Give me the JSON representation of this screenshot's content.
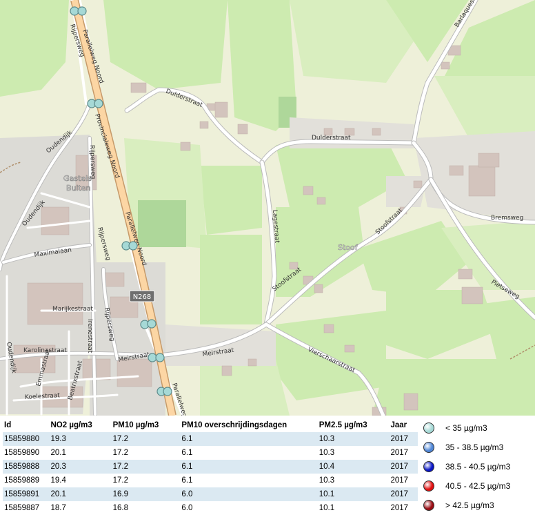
{
  "map": {
    "place_labels": [
      "Gastels",
      "Buiten",
      "Stoof"
    ],
    "shield": "N268",
    "roads": {
      "provincialeweg": "Provincialeweg Noord",
      "parallelweg_top": "Parallelweg Noord",
      "parallelweg_mid": "Parallelweg Noord",
      "parallelweg_bottom": "Parallelweg",
      "rijpersweg_1": "Rijpersweg",
      "rijpersweg_2": "Rijpersweg",
      "rijpersweg_3": "Rijpersweg",
      "rijpersweg_4": "Rijpersweg",
      "dulderstraat_1": "Dulderstraat",
      "dulderstraat_2": "Dulderstraat",
      "oudendijk_1": "Oudendijk",
      "oudendijk_2": "Oudendijk",
      "oudendijk_3": "Oudendijk",
      "maximalaan": "Maximalaan",
      "lagestraat": "Lagestraat",
      "stoofstraat_1": "Stoofstraat",
      "stoofstraat_2": "Stoofstraat",
      "barlaquestraat": "Barlaquest",
      "bremsweg": "Bremsweg",
      "pietseweg": "Pietseweg",
      "marijkestraat": "Marijkestraat",
      "irenestraat": "Irenestraat",
      "karolinastraat": "Karolinastraat",
      "meirstraat_1": "Meirstraat",
      "meirstraat_2": "Meirstraat",
      "vierschaarstraat": "Vierschaarstraat",
      "emmastraat": "Emmastraat",
      "beatrixstraat": "Beatrixstraat",
      "koelestraat": "Koelestraat"
    },
    "marker_color": "#a6d9d6"
  },
  "table": {
    "headers": [
      "Id",
      "NO2 µg/m3",
      "PM10 µg/m3",
      "PM10 overschrijdingsdagen",
      "PM2.5 µg/m3",
      "Jaar"
    ],
    "rows": [
      [
        "15859880",
        "19.3",
        "17.2",
        "6.1",
        "10.3",
        "2017"
      ],
      [
        "15859890",
        "20.1",
        "17.2",
        "6.1",
        "10.3",
        "2017"
      ],
      [
        "15859888",
        "20.3",
        "17.2",
        "6.1",
        "10.4",
        "2017"
      ],
      [
        "15859889",
        "19.4",
        "17.2",
        "6.1",
        "10.3",
        "2017"
      ],
      [
        "15859891",
        "20.1",
        "16.9",
        "6.0",
        "10.1",
        "2017"
      ],
      [
        "15859887",
        "18.7",
        "16.8",
        "6.0",
        "10.1",
        "2017"
      ]
    ]
  },
  "legend": [
    {
      "label": "< 35 µg/m3",
      "color": "#a6d9d6"
    },
    {
      "label": "35 - 38.5 µg/m3",
      "color": "#4f86d6"
    },
    {
      "label": "38.5 - 40.5 µg/m3",
      "color": "#0a16c4"
    },
    {
      "label": "40.5 - 42.5 µg/m3",
      "color": "#e01010"
    },
    {
      "label": "> 42.5 µg/m3",
      "color": "#9a0d14"
    }
  ]
}
